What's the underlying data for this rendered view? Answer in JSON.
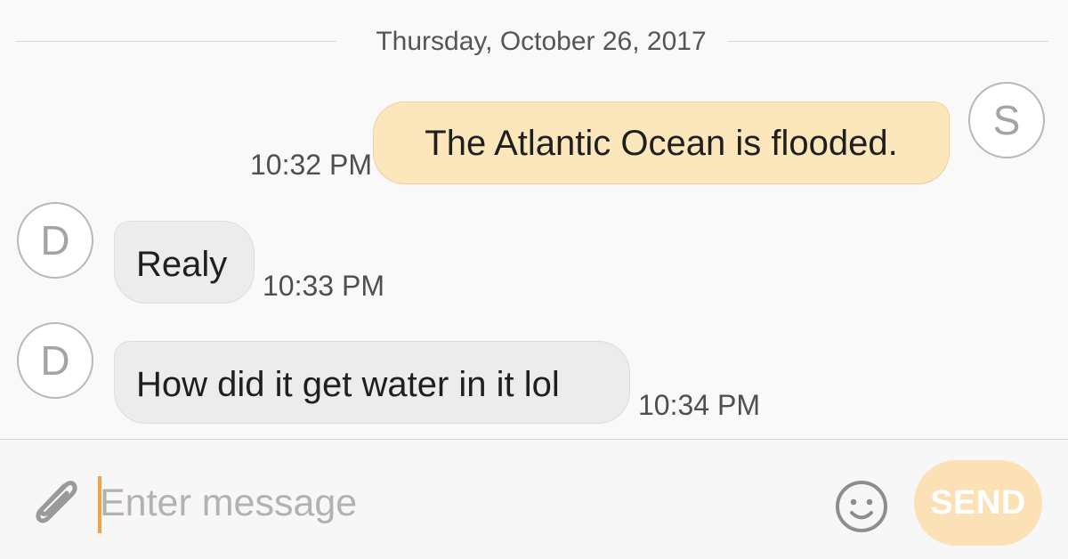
{
  "conversation": {
    "date": "Thursday, October 26, 2017",
    "messages": [
      {
        "direction": "outgoing",
        "sender_initial": "S",
        "text": "The Atlantic Ocean is flooded.",
        "time": "10:32 PM"
      },
      {
        "direction": "incoming",
        "sender_initial": "D",
        "text": "Realy",
        "time": "10:33 PM"
      },
      {
        "direction": "incoming",
        "sender_initial": "D",
        "text": "How did it get water in it lol",
        "time": "10:34 PM"
      }
    ]
  },
  "composer": {
    "placeholder": "Enter message",
    "value": "",
    "send_label": "SEND",
    "attach_icon": "paperclip-icon",
    "emoji_icon": "smiley-icon"
  },
  "colors": {
    "background": "#f9f9f9",
    "outgoing_bubble": "#fbe7bb",
    "incoming_bubble": "#ececec",
    "send_button": "#fbe1b5",
    "cursor": "#f0a14a"
  }
}
